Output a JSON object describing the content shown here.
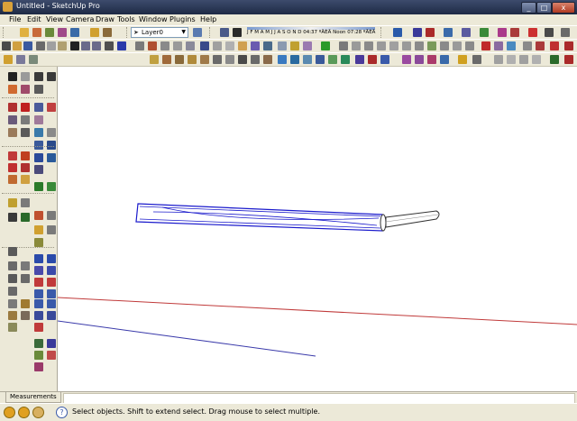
{
  "window": {
    "title": "Untitled - SketchUp Pro",
    "minimize": "_",
    "maximize": "□",
    "close": "x"
  },
  "menus": [
    "File",
    "Edit",
    "View",
    "Camera",
    "Draw",
    "Tools",
    "Window",
    "Plugins",
    "Help"
  ],
  "layers": {
    "current": "Layer0"
  },
  "shadow_settings": {
    "months": "J F M A M J J A S O N D",
    "time": "04:37 ºÄÈÄ",
    "noon": "Noon",
    "time2": "07:28 ºÄÈÄ"
  },
  "measurements": {
    "label": "Measurements"
  },
  "status": {
    "hint": "Select objects. Shift to extend select. Drag mouse to select multiple."
  },
  "colors": {
    "chrome": "#ece9d8",
    "titlebar": "#2a3756",
    "selection": "#1a1acc",
    "red_axis": "#c03a3a",
    "blue_axis": "#3a3aaa"
  }
}
